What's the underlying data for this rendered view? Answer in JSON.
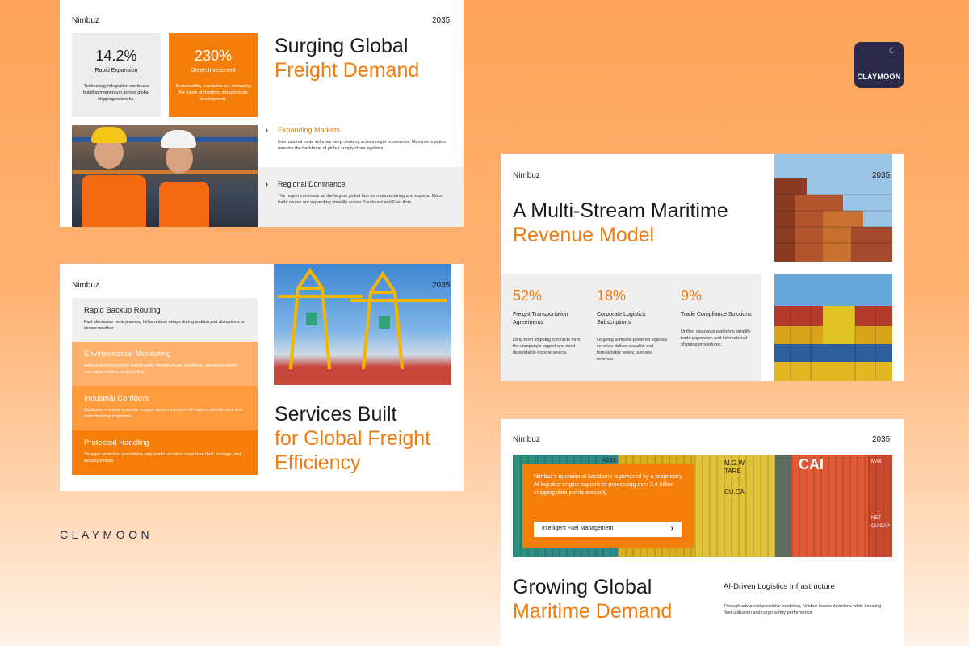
{
  "colors": {
    "accent": "#f57d09",
    "light_accent": "#ffa95e",
    "mid_accent": "#ff9a3d",
    "panel_gray": "#efefef",
    "badge": "#2b2a4a"
  },
  "slide1": {
    "brand": "Nimbuz",
    "year": "2035",
    "stats": [
      {
        "value": "14.2%",
        "label": "Rapid Expansion",
        "desc": "Technology integration continues building momentum across global shipping networks."
      },
      {
        "value": "230%",
        "label": "Green Investment",
        "desc": "Sustainability mandates are reshaping the future of maritime infrastructure development."
      }
    ],
    "title_line1": "Surging Global",
    "title_line2": "Freight Demand",
    "features": [
      {
        "title": "Expanding Markets",
        "desc": "International trade volumes keep climbing across major economies. Maritime logistics remains the backbone of global supply chain systems."
      },
      {
        "title": "Regional Dominance",
        "desc": "The region continues as the largest global hub for manufacturing and exports. Major trade routes are expanding steadily across Southeast and East Asia."
      }
    ],
    "chevron_icon": "chevron-right-icon",
    "photo_icon": "workers-photo"
  },
  "slide2": {
    "brand": "Nimbuz",
    "year": "2035",
    "services": [
      {
        "title": "Rapid Backup Routing",
        "desc": "Fast alternative route planning helps reduce delays during sudden port disruptions or severe weather."
      },
      {
        "title": "Environmental Monitoring",
        "desc": "Advanced tracking tools continuously monitor ocean conditions, emissions levels, and cargo environmental safety."
      },
      {
        "title": "Industrial Corridors",
        "desc": "Dedicated maritime corridors support quicker transport for large-scale industrial and manufacturing shipments."
      },
      {
        "title": "Protected Handling",
        "desc": "Stronger protection procedures help shield sensitive cargo from theft, damage, and security threats."
      }
    ],
    "title_line1": "Services Built",
    "title_line2": "for Global Freight",
    "title_line3": "Efficiency"
  },
  "slide3": {
    "brand": "Nimbuz",
    "year": "2035",
    "title_line1": "A Multi-Stream Maritime",
    "title_line2": "Revenue Model",
    "streams": [
      {
        "pct": "52%",
        "title": "Freight Transportation Agreements",
        "desc": "Long-term shipping contracts form the company's largest and most dependable income source."
      },
      {
        "pct": "18%",
        "title": "Corporate Logistics Subscriptions",
        "desc": "Ongoing software-powered logistics services deliver scalable and forecastable yearly business revenue."
      },
      {
        "pct": "9%",
        "title": "Trade Compliance Solutions",
        "desc": "Unified clearance platforms simplify trade paperwork and international shipping procedures."
      }
    ]
  },
  "slide4": {
    "brand": "Nimbuz",
    "year": "2035",
    "callout_text": "Nimbuz's operational backbone is powered by a proprietary AI logistics engine capable of processing over 3.4 billion shipping data points annually.",
    "button_label": "Intelligent Fuel Management",
    "button_arrow": "›",
    "title_line1": "Growing Global",
    "title_line2": "Maritime Demand",
    "side_title": "AI-Driven Logistics Infrastructure",
    "side_desc": "Through advanced predictive modeling, Nimbuz lowers downtime while boosting fleet utilization and cargo safety performance.",
    "container_marks": [
      "4261",
      "M.G.W.",
      "TARE",
      "CU.CA",
      "CAI",
      "MAX",
      "NET",
      "CU.CAP"
    ]
  },
  "badge": {
    "text": "CLAYMOON",
    "icon": "crescent-moon-icon"
  },
  "wordmark": "CLAYMOON"
}
